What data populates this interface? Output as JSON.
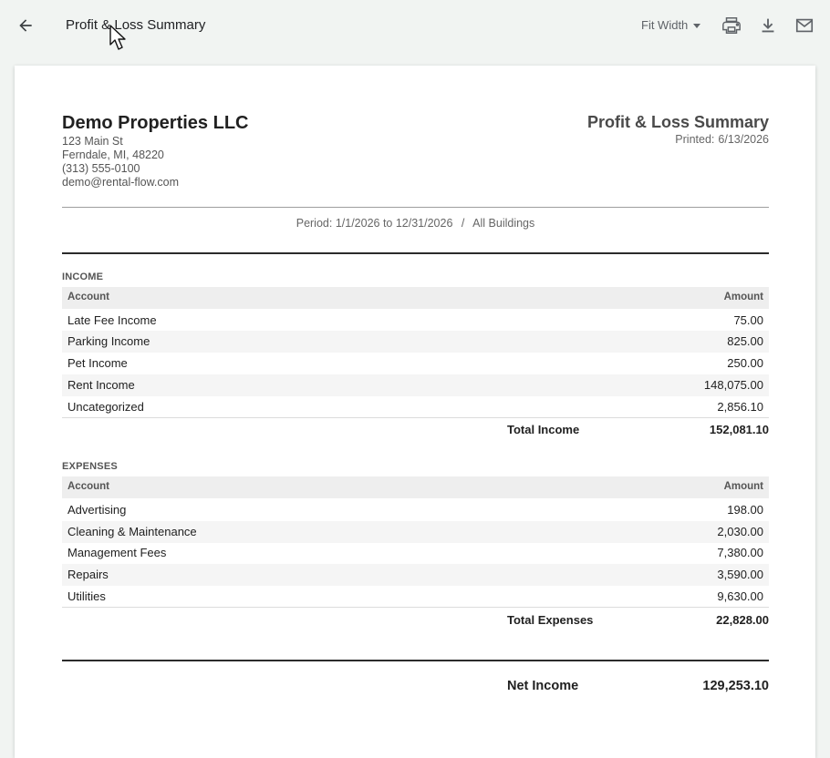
{
  "toolbar": {
    "title": "Profit & Loss Summary",
    "zoom": "Fit Width",
    "icons": [
      "back-arrow-icon",
      "printer-icon",
      "download-icon",
      "mail-icon"
    ]
  },
  "company": {
    "name": "Demo Properties LLC",
    "address_line1": "123 Main St",
    "address_line2": "Ferndale, MI, 48220",
    "phone": "(313) 555-0100",
    "email": "demo@rental-flow.com"
  },
  "report": {
    "title": "Profit & Loss Summary",
    "printed_label": "Printed:",
    "printed_date": "6/13/2026",
    "period_text": "Period: 1/1/2026 to 12/31/2026",
    "period_separator": "/",
    "buildings": "All Buildings"
  },
  "income": {
    "section_title": "INCOME",
    "col_account": "Account",
    "col_amount": "Amount",
    "rows": [
      {
        "account": "Late Fee Income",
        "amount": "75.00"
      },
      {
        "account": "Parking Income",
        "amount": "825.00"
      },
      {
        "account": "Pet Income",
        "amount": "250.00"
      },
      {
        "account": "Rent Income",
        "amount": "148,075.00"
      },
      {
        "account": "Uncategorized",
        "amount": "2,856.10"
      }
    ],
    "total_label": "Total Income",
    "total_value": "152,081.10"
  },
  "expenses": {
    "section_title": "EXPENSES",
    "col_account": "Account",
    "col_amount": "Amount",
    "rows": [
      {
        "account": "Advertising",
        "amount": "198.00"
      },
      {
        "account": "Cleaning & Maintenance",
        "amount": "2,030.00"
      },
      {
        "account": "Management Fees",
        "amount": "7,380.00"
      },
      {
        "account": "Repairs",
        "amount": "3,590.00"
      },
      {
        "account": "Utilities",
        "amount": "9,630.00"
      }
    ],
    "total_label": "Total Expenses",
    "total_value": "22,828.00"
  },
  "net": {
    "label": "Net Income",
    "value": "129,253.10"
  },
  "colors": {
    "app_background": "#f1f4f2",
    "paper": "#ffffff",
    "table_header": "#eeeeee",
    "alt_row": "#f5f5f5"
  }
}
